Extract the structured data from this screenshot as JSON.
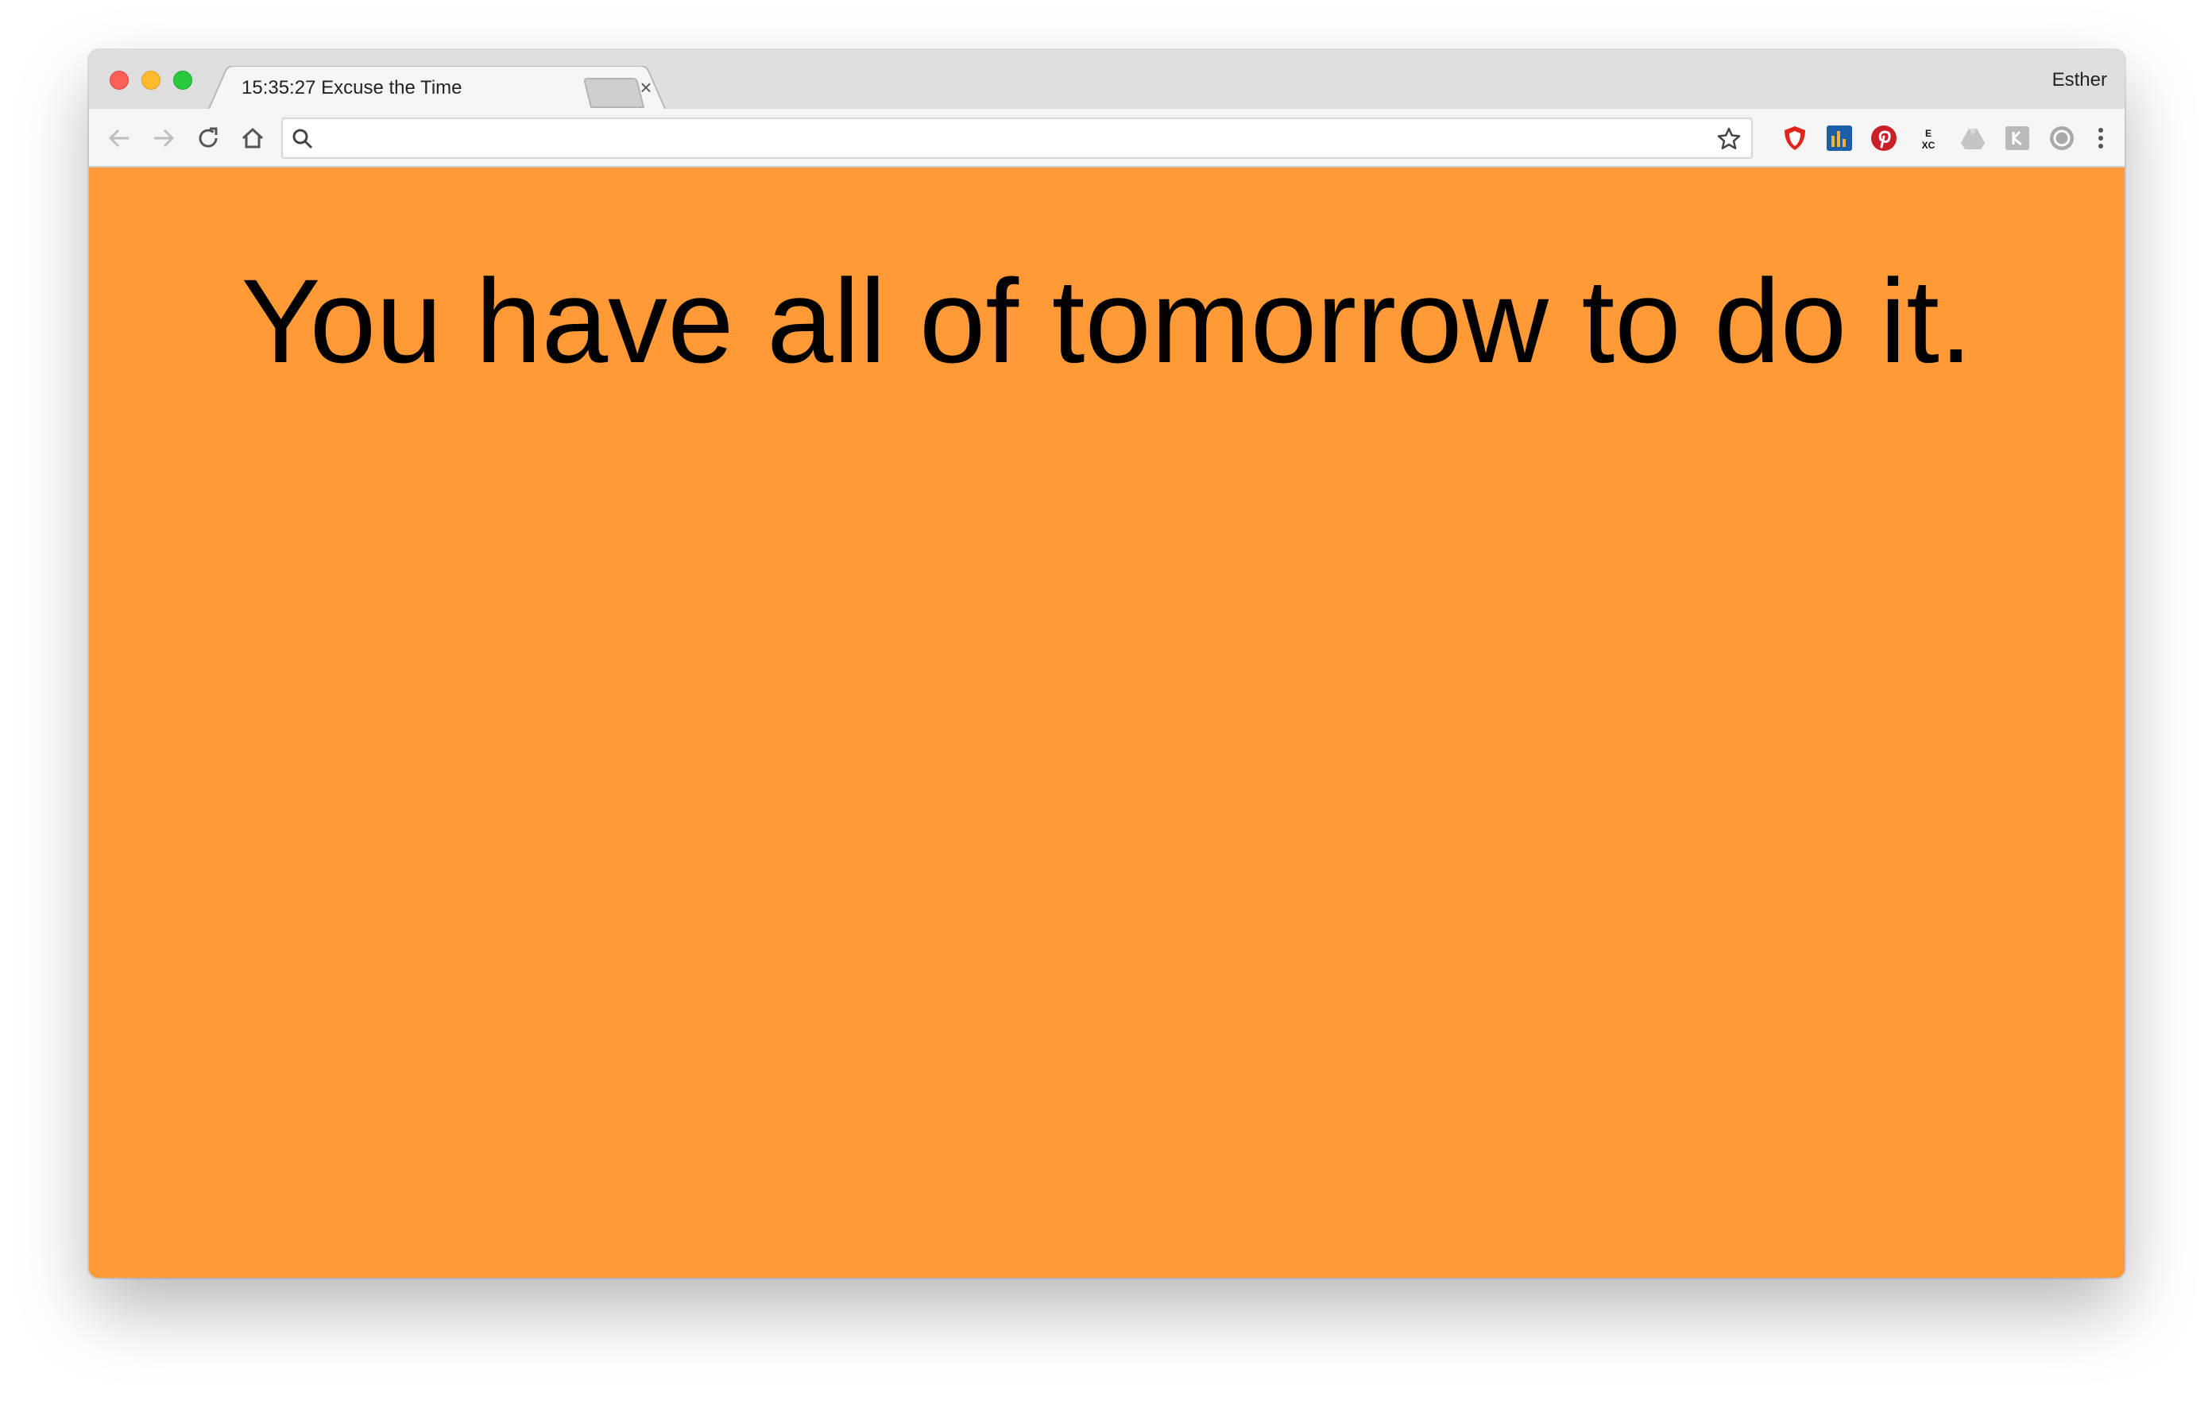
{
  "browser": {
    "tab_title": "15:35:27 Excuse the Time",
    "tab_close": "×",
    "profile_name": "Esther",
    "address_value": "",
    "address_placeholder": ""
  },
  "extensions": [
    {
      "name": "ublock-icon"
    },
    {
      "name": "stats-extension-icon"
    },
    {
      "name": "pinterest-icon"
    },
    {
      "name": "excel-extension-icon",
      "label": "E XC"
    },
    {
      "name": "drive-icon"
    },
    {
      "name": "keyboard-extension-icon"
    },
    {
      "name": "sync-extension-icon"
    }
  ],
  "page": {
    "excuse_text": "You have all of tomorrow to do it.",
    "background_color": "#ff9a36"
  }
}
